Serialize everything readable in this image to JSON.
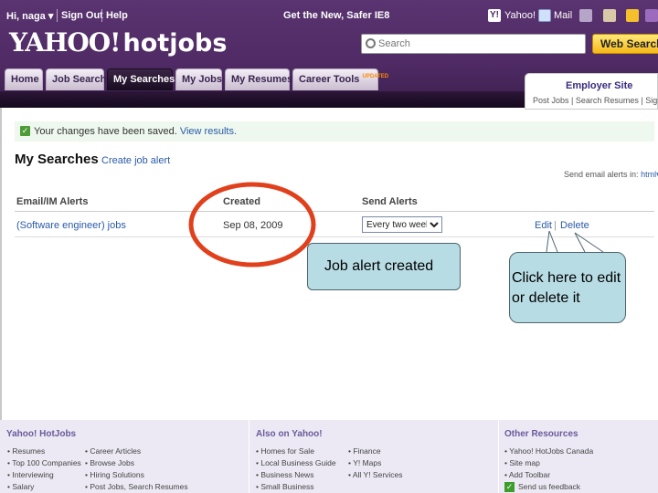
{
  "header": {
    "greeting": "Hi, naga",
    "sign_out": "Sign Out",
    "help": "Help",
    "tagline": "Get the New, Safer IE8",
    "yahoo_link": "Yahoo!",
    "mail_link": "Mail",
    "logo_yahoo": "YAHOO!",
    "logo_hotjobs": "hotjobs",
    "search_placeholder": "Search",
    "web_search_label": "Web Search"
  },
  "tabs": [
    {
      "label": "Home"
    },
    {
      "label": "Job Search"
    },
    {
      "label": "My Searches"
    },
    {
      "label": "My Jobs"
    },
    {
      "label": "My Resumes"
    },
    {
      "label": "Career Tools",
      "badge": "UPDATED"
    }
  ],
  "employer": {
    "title": "Employer Site",
    "links": [
      "Post Jobs",
      "Search Resumes",
      "Sign In"
    ]
  },
  "notice": {
    "text": "Your changes have been saved.",
    "link": "View results."
  },
  "main": {
    "title": "My Searches",
    "create_alert": "Create job alert",
    "send_alerts_label": "Send email alerts in:",
    "send_alerts_format": "html",
    "columns": [
      "Email/IM Alerts",
      "Created",
      "Send Alerts"
    ],
    "rows": [
      {
        "alert": "(Software engineer) jobs",
        "created": "Sep 08, 2009",
        "frequency": "Every two weeks",
        "edit": "Edit",
        "delete": "Delete"
      }
    ]
  },
  "annotations": {
    "job_alert_created": "Job alert created",
    "click_here": "Click here to edit or delete it"
  },
  "footer": {
    "col1": {
      "title": "Yahoo! HotJobs",
      "links_a": [
        "Resumes",
        "Top 100 Companies",
        "Interviewing",
        "Salary"
      ],
      "links_b": [
        "Career Articles",
        "Browse Jobs",
        "Hiring Solutions",
        "Post Jobs, Search Resumes"
      ]
    },
    "col2": {
      "title": "Also on Yahoo!",
      "links_a": [
        "Homes for Sale",
        "Local Business Guide",
        "Business News",
        "Small Business"
      ],
      "links_b": [
        "Finance",
        "Y! Maps",
        "All Y! Services"
      ]
    },
    "col3": {
      "title": "Other Resources",
      "links": [
        "Yahoo! HotJobs Canada",
        "Site map",
        "Add Toolbar",
        "Send us feedback"
      ]
    }
  },
  "colors": {
    "brand_purple": "#4f2a64",
    "link_blue": "#2a5aa8",
    "annotation_circle": "#e0401c",
    "callout_fill": "#b8dce4"
  }
}
